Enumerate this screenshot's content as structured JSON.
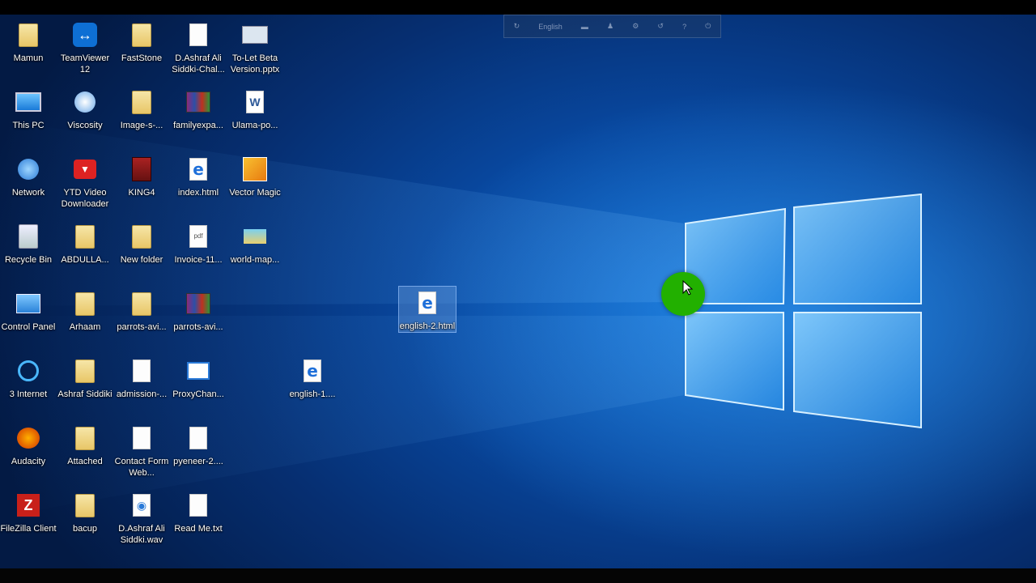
{
  "toolbar": {
    "language": "English",
    "icons": [
      "settings-icon",
      "keyboard-icon",
      "user-icon",
      "gear-icon",
      "edge-icon",
      "help-icon",
      "power-icon"
    ]
  },
  "desktop_icons": [
    {
      "label": "Mamun",
      "type": "user-folder"
    },
    {
      "label": "TeamViewer 12",
      "type": "teamviewer"
    },
    {
      "label": "FastStone",
      "type": "folder"
    },
    {
      "label": "D.Ashraf Ali Siddki-Chal...",
      "type": "document"
    },
    {
      "label": "To-Let Beta Version.pptx",
      "type": "presentation"
    },
    {
      "label": "This PC",
      "type": "computer"
    },
    {
      "label": "Viscosity",
      "type": "viscosity"
    },
    {
      "label": "Image-s-...",
      "type": "folder"
    },
    {
      "label": "familyexpa...",
      "type": "winrar"
    },
    {
      "label": "Ulama-po...",
      "type": "word"
    },
    {
      "label": "Network",
      "type": "network"
    },
    {
      "label": "YTD Video Downloader",
      "type": "ytd"
    },
    {
      "label": "KING4",
      "type": "king4"
    },
    {
      "label": "index.html",
      "type": "html"
    },
    {
      "label": "Vector Magic",
      "type": "vectormagic"
    },
    {
      "label": "Recycle Bin",
      "type": "recyclebin"
    },
    {
      "label": "ABDULLA...",
      "type": "folder"
    },
    {
      "label": "New folder",
      "type": "folder"
    },
    {
      "label": "Invoice-11...",
      "type": "pdf"
    },
    {
      "label": "world-map...",
      "type": "image"
    },
    {
      "label": "Control Panel",
      "type": "controlpanel"
    },
    {
      "label": "Arhaam",
      "type": "folder"
    },
    {
      "label": "parrots-avi...",
      "type": "folder"
    },
    {
      "label": "parrots-avi...",
      "type": "winrar"
    },
    {
      "label": "3 Internet",
      "type": "internet"
    },
    {
      "label": "Ashraf Siddiki",
      "type": "folder"
    },
    {
      "label": "admission-...",
      "type": "document"
    },
    {
      "label": "ProxyChan...",
      "type": "proxy"
    },
    {
      "label": "english-1....",
      "type": "html"
    },
    {
      "label": "Audacity",
      "type": "audacity"
    },
    {
      "label": "Attached",
      "type": "folder"
    },
    {
      "label": "Contact Form Web...",
      "type": "document"
    },
    {
      "label": "pyeneer-2....",
      "type": "document"
    },
    {
      "label": "FileZilla Client",
      "type": "filezilla"
    },
    {
      "label": "bacup",
      "type": "folder"
    },
    {
      "label": "D.Ashraf Ali Siddki.wav",
      "type": "audio"
    },
    {
      "label": "Read Me.txt",
      "type": "text"
    },
    {
      "label": "english-2.html",
      "type": "html",
      "selected": true
    }
  ]
}
